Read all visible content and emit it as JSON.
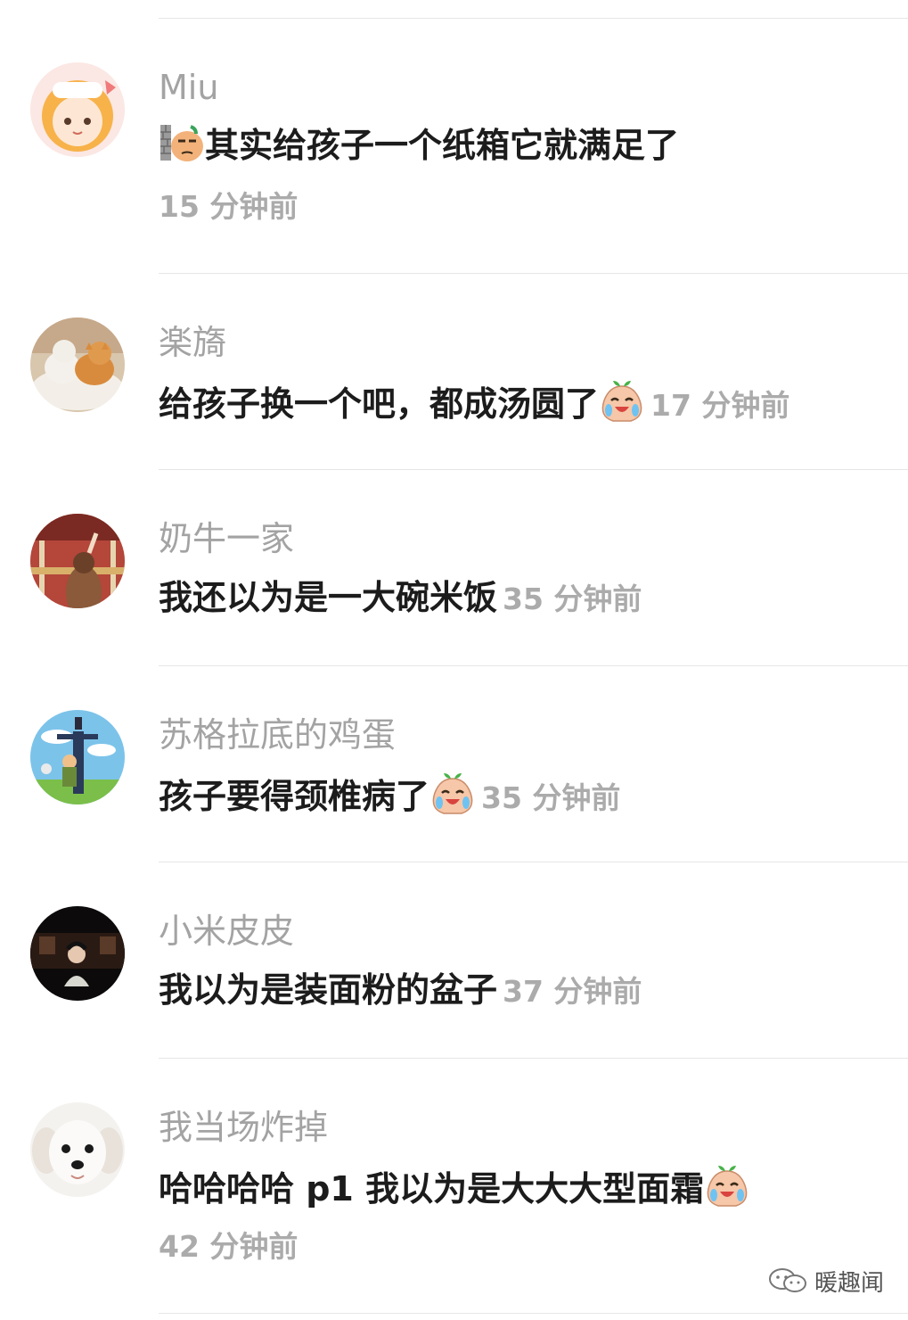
{
  "comments": [
    {
      "user": "Miu",
      "text": "其实给孩子一个纸箱它就满足了",
      "time": "15 分钟前",
      "emoji_before": "doge-wall-icon"
    },
    {
      "user": "楽旖",
      "text": "给孩子换一个吧，都成汤圆了",
      "time": "17 分钟前",
      "emoji_after": "crying-laugh-peach-icon"
    },
    {
      "user": "奶牛一家",
      "text": "我还以为是一大碗米饭",
      "time": "35 分钟前"
    },
    {
      "user": "苏格拉底的鸡蛋",
      "text": "孩子要得颈椎病了",
      "time": "35 分钟前",
      "emoji_after": "crying-laugh-peach-icon"
    },
    {
      "user": "小米皮皮",
      "text": "我以为是装面粉的盆子",
      "time": "37 分钟前"
    },
    {
      "user": "我当场炸掉",
      "text": "哈哈哈哈 p1 我以为是大大大型面霜",
      "time": "42 分钟前",
      "emoji_after": "crying-laugh-peach-icon"
    }
  ],
  "watermark": {
    "label": "暖趣闻",
    "icon": "wechat-icon"
  }
}
